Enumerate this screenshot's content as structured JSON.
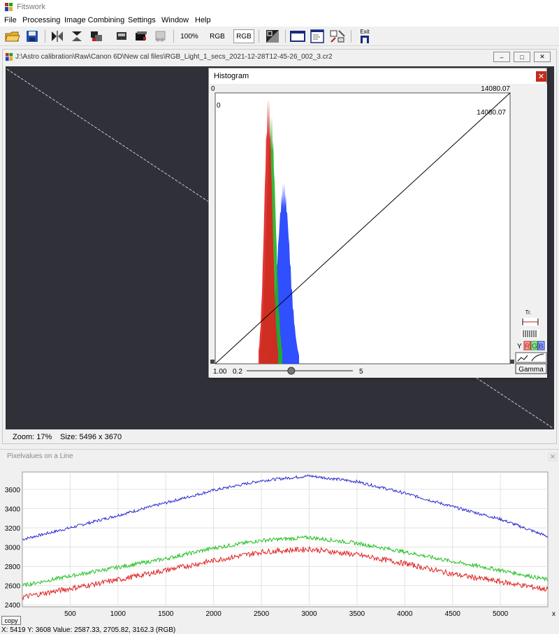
{
  "app": {
    "title": "Fitswork"
  },
  "menu": [
    "File",
    "Processing",
    "Image Combining",
    "Settings",
    "Window",
    "Help"
  ],
  "toolbar": {
    "zoom_label": "100%",
    "rgb_label_1": "RGB",
    "rgb_label_2": "RGB",
    "exit_label": "Exit",
    "icons": [
      "open-icon",
      "save-icon",
      "flip-horizontal-icon",
      "flip-vertical-icon",
      "rotate-icon",
      "print-icon",
      "black-card-icon",
      "crop-icon",
      "contrast-icon",
      "window-icon",
      "document-icon",
      "tools-icon",
      "exit-icon"
    ]
  },
  "image_window": {
    "title": "J:\\Astro calibration\\Raw\\Canon 6D\\New cal files\\RGB_Light_1_secs_2021-12-28T12-45-26_002_3.cr2",
    "zoom": "Zoom: 17%",
    "size": "Size: 5496 x 3670"
  },
  "histogram": {
    "title": "Histogram",
    "left_min": "0",
    "top_right": "14080.07",
    "inner_min": "0",
    "inner_right": "14080.07",
    "gamma_value": "1.00",
    "slider_min": "0.2",
    "slider_max": "5",
    "slider_pos": 0.42,
    "gamma_button": "Gamma",
    "tr_label": "Tr.",
    "channel_y": "Y",
    "channel_r": "R",
    "channel_g": "G",
    "channel_b": "B",
    "colors": {
      "red": "#e02020",
      "green": "#22b022",
      "blue": "#1a3cff"
    }
  },
  "pixel_window": {
    "title": "Pixelvalues on a Line",
    "copy_label": "copy",
    "status": "X: 5419  Y: 3608  Value: 2587.33, 2705.82, 3162.3 (RGB)"
  },
  "chart_data": {
    "type": "line",
    "xlabel": "x",
    "ylabel": "",
    "xlim": [
      0,
      5496
    ],
    "ylim": [
      2380,
      3780
    ],
    "xticks": [
      500,
      1000,
      1500,
      2000,
      2500,
      3000,
      3500,
      4000,
      4500,
      5000
    ],
    "yticks": [
      2400,
      2600,
      2800,
      3000,
      3200,
      3400,
      3600
    ],
    "grid": true,
    "x": [
      0,
      500,
      1000,
      1500,
      2000,
      2500,
      3000,
      3500,
      4000,
      4500,
      5000,
      5496
    ],
    "series": [
      {
        "name": "",
        "color": "#2b2bd0",
        "values": [
          3080,
          3200,
          3330,
          3460,
          3590,
          3690,
          3740,
          3680,
          3560,
          3420,
          3290,
          3110
        ]
      },
      {
        "name": "",
        "color": "#22c022",
        "values": [
          2600,
          2700,
          2790,
          2880,
          2990,
          3070,
          3100,
          3040,
          2950,
          2850,
          2760,
          2660
        ]
      },
      {
        "name": "",
        "color": "#e02020",
        "values": [
          2480,
          2570,
          2660,
          2760,
          2860,
          2950,
          2980,
          2920,
          2830,
          2720,
          2640,
          2560
        ]
      }
    ]
  }
}
